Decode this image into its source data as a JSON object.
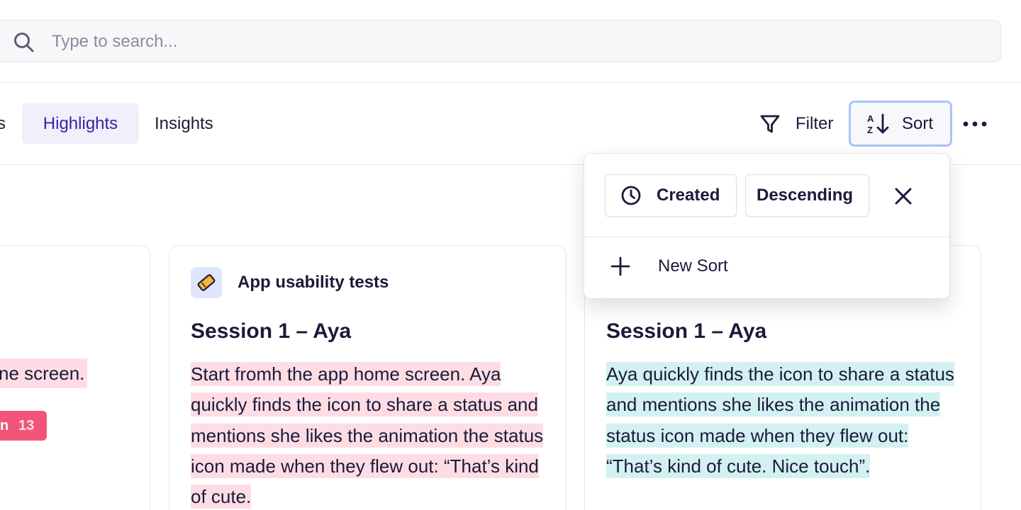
{
  "search": {
    "placeholder": "Type to search..."
  },
  "tabs": [
    {
      "label": "s"
    },
    {
      "label": "Highlights",
      "active": true
    },
    {
      "label": "Insights"
    }
  ],
  "toolbar": {
    "filter_label": "Filter",
    "sort_label": "Sort",
    "more_icon": "more-horizontal-icon"
  },
  "sort_menu": {
    "field": "Created",
    "field_icon": "clock-icon",
    "direction": "Descending",
    "new_sort_label": "New Sort"
  },
  "cards": {
    "left": {
      "text": "ne screen.",
      "tag_label": "n",
      "tag_count": "13",
      "tag_color": "#f25478"
    },
    "middle": {
      "project": "App usability tests",
      "project_icon": "ticket-icon",
      "title": "Session 1 – Aya",
      "highlight": "Start fromh the app home screen. Aya quickly finds the icon to share a status and mentions she likes the animation the status icon made when they flew out: “That’s kind of cute.",
      "highlight_color": "#fddde3"
    },
    "right": {
      "title": "Session 1 – Aya",
      "highlight": "Aya quickly finds the icon to share a status and mentions she likes the animation the status icon made when they flew out: “That’s kind of cute. Nice touch”.",
      "highlight_color": "#d3f1f1"
    }
  },
  "colors": {
    "accent": "#3b1fa7",
    "sort_focus": "#a9c4f4",
    "tab_active_bg": "#f0effa"
  }
}
